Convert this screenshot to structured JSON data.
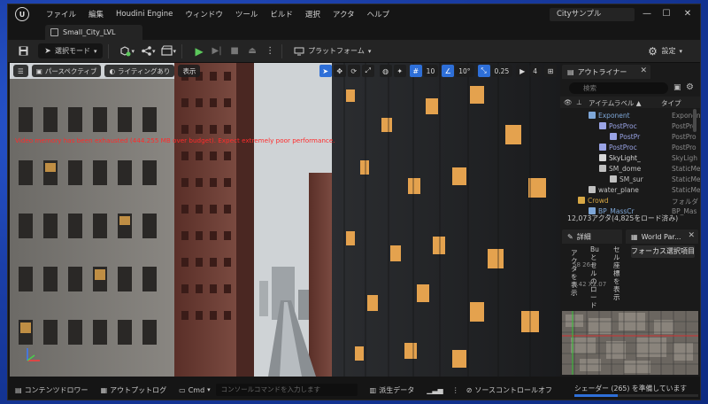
{
  "app": {
    "logo": "U",
    "project_name": "Cityサンプル",
    "menu": [
      "ファイル",
      "編集",
      "Houdini Engine",
      "ウィンドウ",
      "ツール",
      "ビルド",
      "選択",
      "アクタ",
      "ヘルプ"
    ],
    "window_controls": [
      "—",
      "☐",
      "✕"
    ]
  },
  "level_tab": {
    "label": "Small_City_LVL"
  },
  "toolbar": {
    "select_mode": "選択モード",
    "platform": "プラットフォーム",
    "settings": "設定"
  },
  "viewport": {
    "perspective": "パースペクティブ",
    "lighting": "ライティングあり",
    "show": "表示",
    "grid_snap": "10",
    "rot_snap": "10°",
    "scale_snap": "0.25",
    "camera_speed": "4",
    "warning": "Video memory has been exhausted (444.255 MB over budget). Expect extremely poor performance."
  },
  "outliner": {
    "tab_label": "アウトライナー",
    "search_placeholder": "検索",
    "col_label": "アイテムラベル ▲",
    "col_type": "タイプ",
    "rows": [
      {
        "label": "Exponent",
        "type": "Exponen",
        "indent": 56,
        "color": "#7ea7d8"
      },
      {
        "label": "PostProc",
        "type": "PostPro",
        "indent": 68,
        "color": "#9aa4e6"
      },
      {
        "label": "PostPr",
        "type": "PostPro",
        "indent": 80,
        "color": "#9aa4e6"
      },
      {
        "label": "PostProc",
        "type": "PostPro",
        "indent": 68,
        "color": "#9aa4e6"
      },
      {
        "label": "SkyLight_",
        "type": "SkyLigh",
        "indent": 68,
        "color": "#d8d8d8"
      },
      {
        "label": "SM_dome",
        "type": "StaticMe",
        "indent": 68,
        "color": "#c0c0c0"
      },
      {
        "label": "SM_sur",
        "type": "StaticMe",
        "indent": 80,
        "color": "#c0c0c0"
      },
      {
        "label": "water_plane",
        "type": "StaticMe",
        "indent": 56,
        "color": "#c0c0c0"
      },
      {
        "label": "Crowd",
        "type": "フォルダ",
        "indent": 44,
        "color": "#d8a845"
      },
      {
        "label": "BP_MassCr",
        "type": "BP_Mas",
        "indent": 56,
        "color": "#7ea7d8"
      }
    ],
    "actor_count": "12,073アクタ(4,825をロード済み)"
  },
  "details": {
    "tab_label": "詳細",
    "world_tab": "World Par...",
    "focus_button": "フォーカス選択項目",
    "col_a": "アクタを表示",
    "col_b": "Buとセルのロード",
    "col_c": "セル座標を表示",
    "coord_a": "58 26.0",
    "coord_b": "3.42 X2.07"
  },
  "statusbar": {
    "content_drawer": "コンテンツドロワー",
    "output_log": "アウトプットログ",
    "cmd": "Cmd",
    "cmd_placeholder": "コンソールコマンドを入力します",
    "derived_data": "派生データ",
    "source_control": "ソースコントロールオフ",
    "shader_status": "シェーダー (265) を準備しています",
    "shader_progress": 0.35
  },
  "colors": {
    "accent": "#2e6fd8",
    "warning": "#ff2b2b",
    "play": "#5cc85c"
  }
}
